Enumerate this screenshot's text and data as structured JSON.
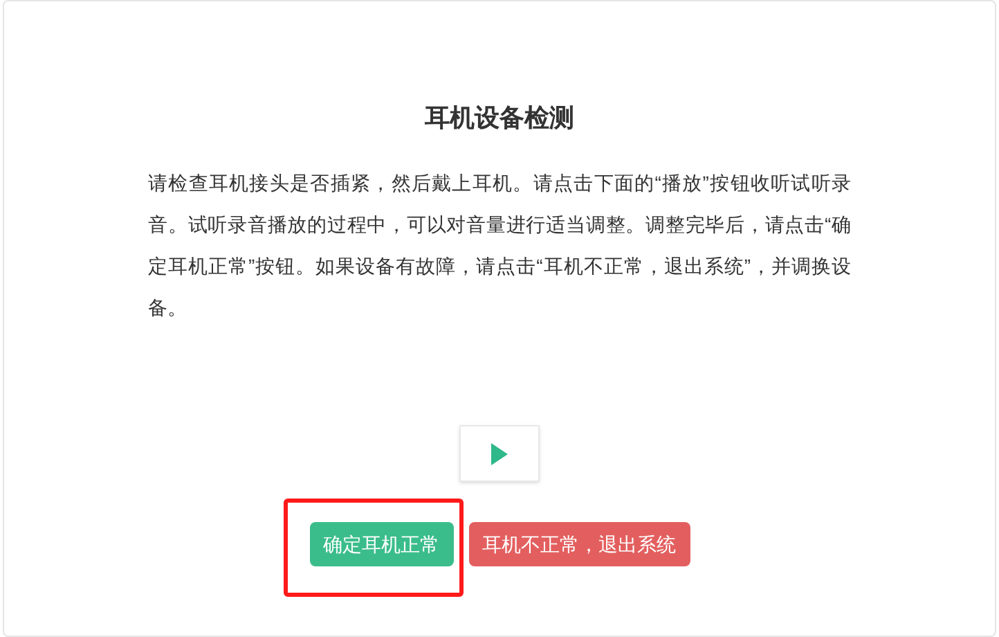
{
  "title": "耳机设备检测",
  "instructions": "请检查耳机接头是否插紧，然后戴上耳机。请点击下面的“播放”按钮收听试听录音。试听录音播放的过程中，可以对音量进行适当调整。调整完毕后，请点击“确定耳机正常”按钮。如果设备有故障，请点击“耳机不正常，退出系统”，并调换设备。",
  "buttons": [
    {
      "label": "确定耳机正常",
      "kind": "confirm",
      "highlighted": true
    },
    {
      "label": "耳机不正常，退出系统",
      "kind": "cancel",
      "highlighted": false
    }
  ]
}
